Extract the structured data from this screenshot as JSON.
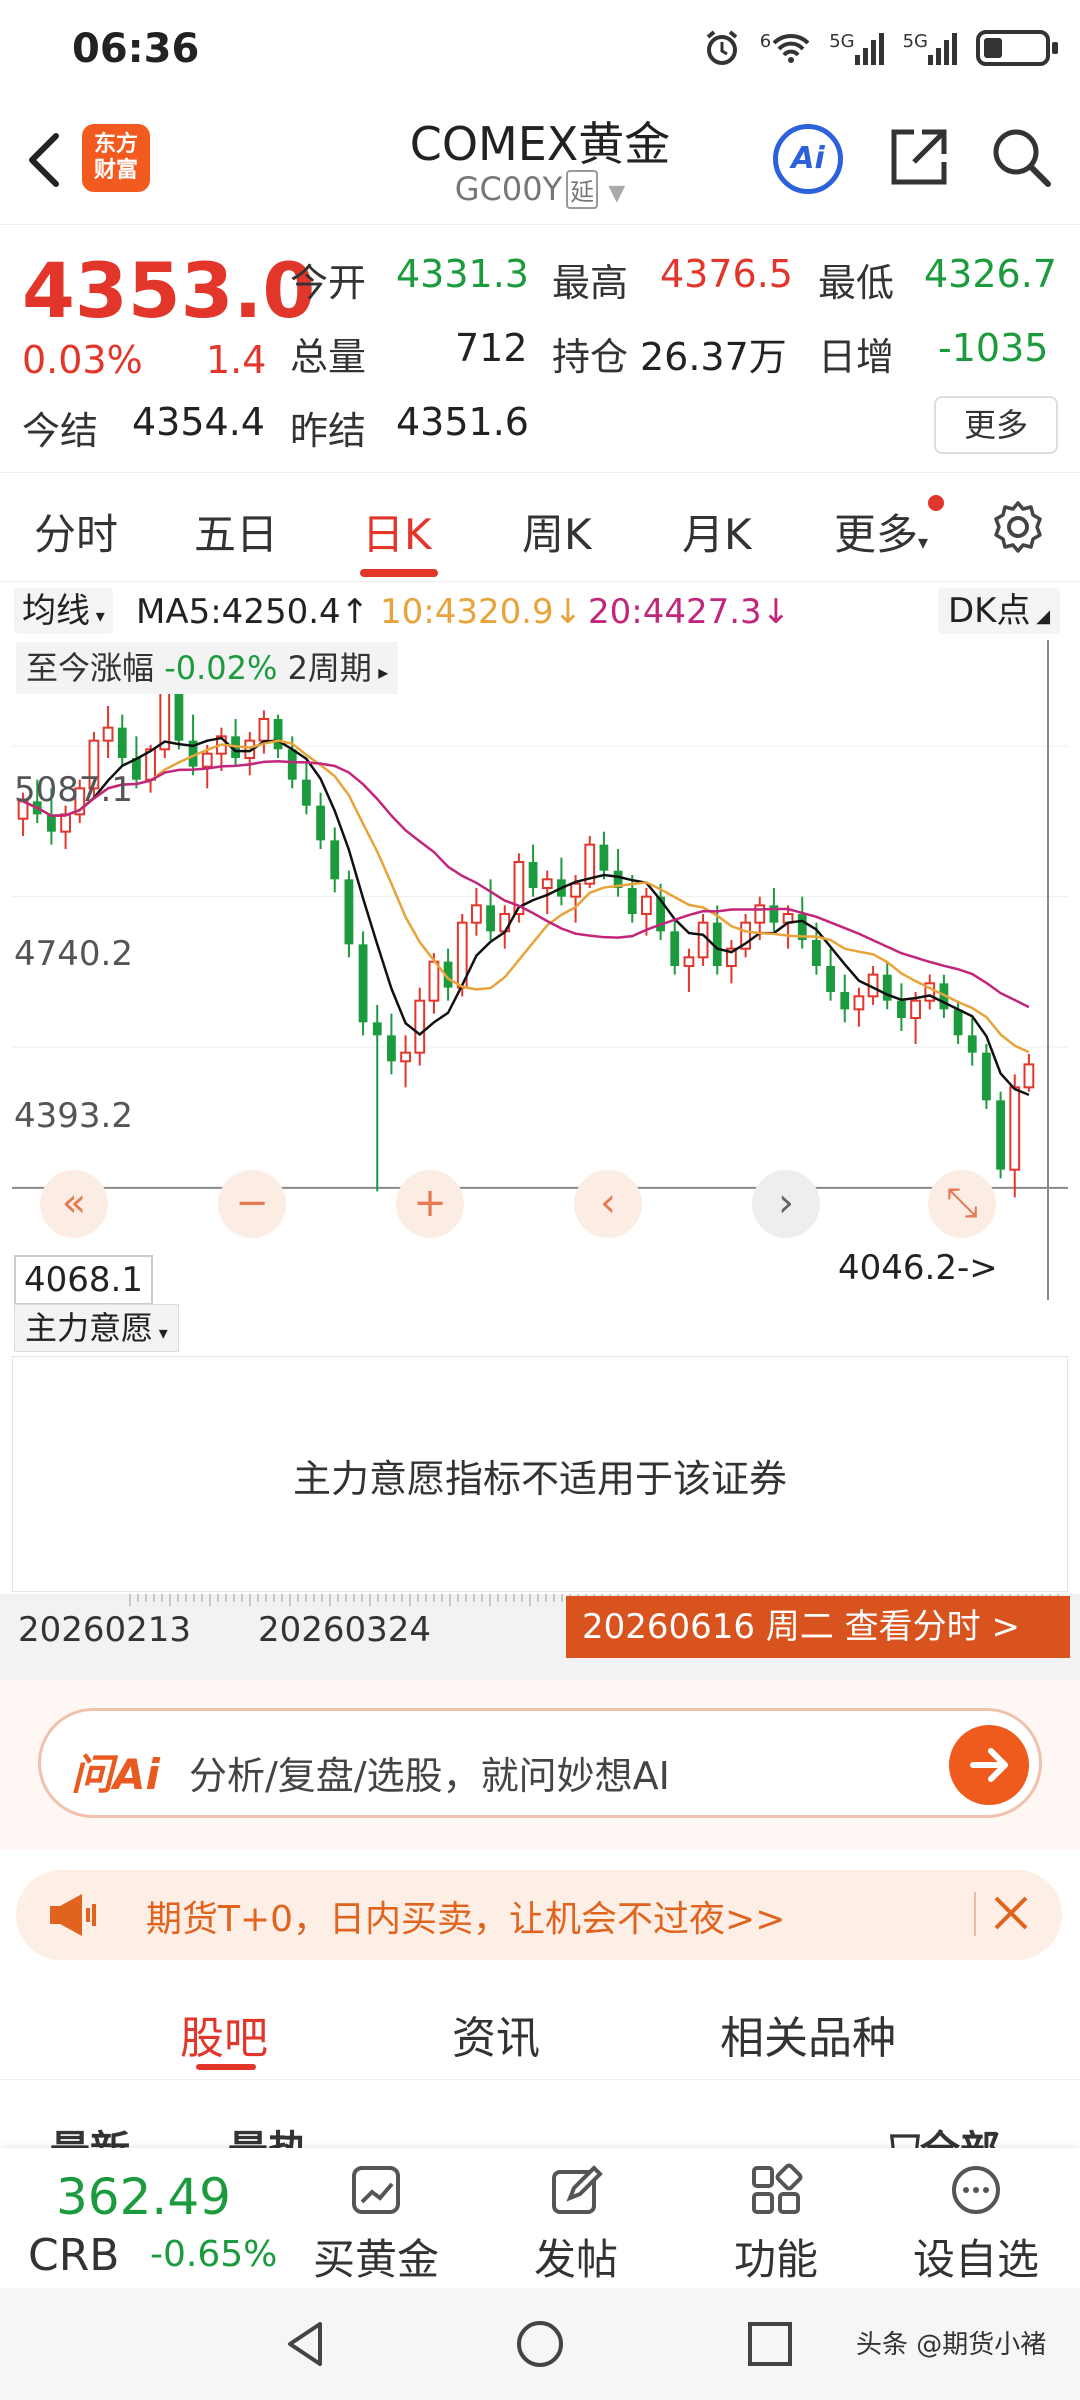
{
  "status_bar": {
    "time": "06:36",
    "net1": "5G",
    "net2": "5G",
    "wifi_sup": "6"
  },
  "header": {
    "logo_line1": "东方",
    "logo_line2": "财富",
    "title": "COMEX黄金",
    "code": "GC00Y",
    "delay_badge": "延",
    "ai_label": "Ai"
  },
  "quote": {
    "price": "4353.0",
    "pct": "0.03%",
    "change": "1.4",
    "open_label": "今开",
    "open": "4331.3",
    "high_label": "最高",
    "high": "4376.5",
    "low_label": "最低",
    "low": "4326.7",
    "vol_label": "总量",
    "vol": "712",
    "oi_label": "持仓",
    "oi": "26.37万",
    "daily_inc_label": "日增",
    "daily_inc": "-1035",
    "settle_label": "今结",
    "settle": "4354.4",
    "prev_settle_label": "昨结",
    "prev_settle": "4351.6",
    "more_button": "更多"
  },
  "tabs": [
    "分时",
    "五日",
    "日K",
    "周K",
    "月K",
    "更多"
  ],
  "ma": {
    "selector": "均线",
    "ma5": "MA5:4250.4",
    "ma10": "10:4320.9",
    "ma20": "20:4427.3",
    "dk_button": "DK点"
  },
  "since": {
    "label": "至今涨幅",
    "value": "-0.02%",
    "period": "2周期"
  },
  "price_axis": {
    "p1": "5087.1",
    "p2": "4740.2",
    "p3": "4393.2",
    "p4": "4068.1"
  },
  "low_marker": "4046.2->",
  "mainforce": {
    "selector": "主力意愿",
    "message": "主力意愿指标不适用于该证券"
  },
  "dates": {
    "d1": "20260213",
    "d2": "20260324",
    "button": "20260616 周二 查看分时 >"
  },
  "ai_bar": {
    "logo": "问Ai",
    "text": "分析/复盘/选股，就问妙想AI"
  },
  "promo": {
    "text": "期货T+0，日内买卖，让机会不过夜>>"
  },
  "subtabs": [
    "股吧",
    "资讯",
    "相关品种"
  ],
  "sort": {
    "latest": "最新",
    "hot": "最热",
    "all": "全部"
  },
  "bottom": {
    "crb_value": "362.49",
    "crb_name": "CRB",
    "crb_pct": "-0.65%",
    "items": [
      "买黄金",
      "发帖",
      "功能",
      "设自选"
    ]
  },
  "watermark": "头条 @期货小褚",
  "colors": {
    "up": "#e2362b",
    "down": "#1b9b3d",
    "accent": "#e0641e",
    "ma5": "#111111",
    "ma10": "#e8a33a",
    "ma20": "#c2267c"
  },
  "chart_data": {
    "type": "candlestick",
    "axis_labels": [
      "5087.1",
      "4740.2",
      "4393.2"
    ],
    "ma_legend": {
      "MA5": 4250.4,
      "MA10": 4320.9,
      "MA20": 4427.3
    },
    "range_low": 4068.1,
    "period_low": 4046.2,
    "candles": [
      [
        4920,
        4980,
        4880,
        4960
      ],
      [
        4960,
        5010,
        4910,
        4930
      ],
      [
        4930,
        4990,
        4860,
        4890
      ],
      [
        4890,
        4950,
        4850,
        4930
      ],
      [
        4930,
        5010,
        4910,
        4990
      ],
      [
        4990,
        5120,
        4970,
        5100
      ],
      [
        5100,
        5180,
        5060,
        5130
      ],
      [
        5130,
        5160,
        5040,
        5060
      ],
      [
        5060,
        5110,
        4990,
        5010
      ],
      [
        5010,
        5090,
        4980,
        5080
      ],
      [
        5080,
        5230,
        5060,
        5210
      ],
      [
        5210,
        5240,
        5080,
        5100
      ],
      [
        5100,
        5160,
        5020,
        5040
      ],
      [
        5040,
        5090,
        4990,
        5070
      ],
      [
        5070,
        5130,
        5030,
        5110
      ],
      [
        5110,
        5150,
        5040,
        5060
      ],
      [
        5060,
        5120,
        5020,
        5100
      ],
      [
        5100,
        5170,
        5070,
        5150
      ],
      [
        5150,
        5160,
        5060,
        5080
      ],
      [
        5080,
        5110,
        4990,
        5010
      ],
      [
        5010,
        5050,
        4930,
        4950
      ],
      [
        4950,
        4980,
        4850,
        4870
      ],
      [
        4870,
        4900,
        4750,
        4780
      ],
      [
        4780,
        4800,
        4600,
        4630
      ],
      [
        4630,
        4660,
        4420,
        4450
      ],
      [
        4450,
        4490,
        4060,
        4420
      ],
      [
        4420,
        4470,
        4330,
        4360
      ],
      [
        4360,
        4420,
        4300,
        4380
      ],
      [
        4380,
        4530,
        4350,
        4500
      ],
      [
        4500,
        4610,
        4470,
        4590
      ],
      [
        4590,
        4620,
        4500,
        4530
      ],
      [
        4530,
        4700,
        4510,
        4680
      ],
      [
        4680,
        4760,
        4650,
        4720
      ],
      [
        4720,
        4780,
        4640,
        4660
      ],
      [
        4660,
        4720,
        4620,
        4700
      ],
      [
        4700,
        4840,
        4680,
        4820
      ],
      [
        4820,
        4860,
        4740,
        4760
      ],
      [
        4760,
        4800,
        4700,
        4780
      ],
      [
        4780,
        4830,
        4720,
        4740
      ],
      [
        4740,
        4790,
        4680,
        4770
      ],
      [
        4770,
        4880,
        4760,
        4860
      ],
      [
        4860,
        4890,
        4780,
        4800
      ],
      [
        4800,
        4850,
        4740,
        4760
      ],
      [
        4760,
        4790,
        4680,
        4700
      ],
      [
        4700,
        4760,
        4650,
        4740
      ],
      [
        4740,
        4770,
        4640,
        4660
      ],
      [
        4660,
        4690,
        4560,
        4580
      ],
      [
        4580,
        4620,
        4520,
        4600
      ],
      [
        4600,
        4700,
        4580,
        4680
      ],
      [
        4680,
        4720,
        4560,
        4580
      ],
      [
        4580,
        4640,
        4540,
        4620
      ],
      [
        4620,
        4700,
        4600,
        4680
      ],
      [
        4680,
        4740,
        4640,
        4720
      ],
      [
        4720,
        4760,
        4660,
        4680
      ],
      [
        4680,
        4720,
        4620,
        4700
      ],
      [
        4700,
        4740,
        4620,
        4640
      ],
      [
        4640,
        4680,
        4560,
        4580
      ],
      [
        4580,
        4620,
        4500,
        4520
      ],
      [
        4520,
        4560,
        4450,
        4480
      ],
      [
        4480,
        4530,
        4440,
        4510
      ],
      [
        4510,
        4580,
        4490,
        4560
      ],
      [
        4560,
        4590,
        4480,
        4500
      ],
      [
        4500,
        4540,
        4430,
        4460
      ],
      [
        4460,
        4520,
        4400,
        4500
      ],
      [
        4500,
        4560,
        4480,
        4540
      ],
      [
        4540,
        4560,
        4460,
        4480
      ],
      [
        4480,
        4500,
        4400,
        4420
      ],
      [
        4420,
        4460,
        4350,
        4380
      ],
      [
        4380,
        4400,
        4250,
        4270
      ],
      [
        4270,
        4290,
        4090,
        4110
      ],
      [
        4110,
        4330,
        4046,
        4300
      ],
      [
        4300,
        4377,
        4290,
        4353
      ]
    ]
  }
}
